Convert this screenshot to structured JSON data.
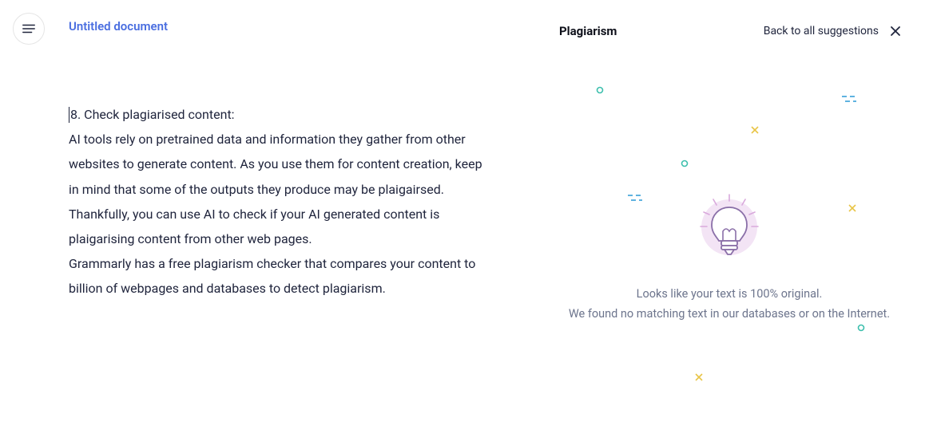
{
  "document": {
    "title": "Untitled document",
    "content_p1": "8. Check plagiarised content:\nAI tools rely on pretrained data and information they gather from other websites to generate content. As you use them for content creation, keep in mind that some of the outputs they produce may be plaigairsed. Thankfully, you can use AI to check if your AI generated content is plaigarising content from other web pages.",
    "content_p2": "Grammarly has a free plagiarism checker that compares your content to billion of webpages and databases to detect plagiarism."
  },
  "panel": {
    "title": "Plagiarism",
    "back_label": "Back to all suggestions",
    "result_line1": "Looks like your text is 100% original.",
    "result_line2": "We found no matching text in our databases or on the Internet."
  },
  "colors": {
    "title_blue": "#4a6ee0",
    "text_dark": "#1f243c",
    "text_muted": "#6d758d",
    "bulb_bg": "#f3e4f5",
    "bulb_stroke": "#8a6fa8",
    "accent_teal": "#3dbfad",
    "accent_yellow": "#e8c547",
    "accent_blue": "#5fb3e0"
  }
}
